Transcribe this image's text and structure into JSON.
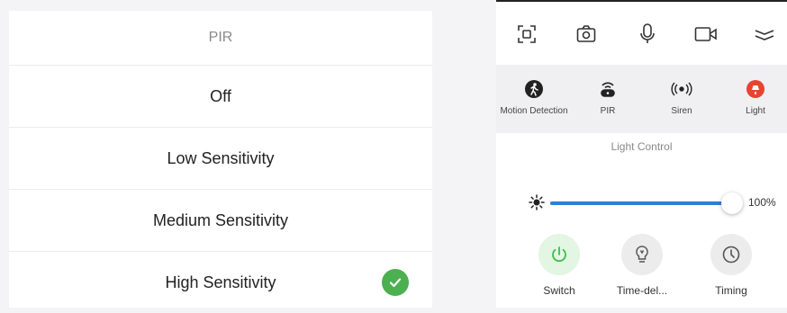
{
  "pir_menu": {
    "title": "PIR",
    "options": [
      "Off",
      "Low Sensitivity",
      "Medium Sensitivity",
      "High Sensitivity"
    ],
    "selected": "High Sensitivity"
  },
  "toolbar": {
    "icons": [
      "screen-capture-icon",
      "camera-icon",
      "microphone-icon",
      "video-icon",
      "collapse-icon"
    ]
  },
  "features": {
    "items": [
      {
        "label": "Motion Detection",
        "icon": "motion-detection-icon"
      },
      {
        "label": "PIR",
        "icon": "pir-icon"
      },
      {
        "label": "Siren",
        "icon": "siren-icon"
      },
      {
        "label": "Light",
        "icon": "light-icon",
        "color": "#e8442e"
      }
    ]
  },
  "light_control": {
    "title": "Light Control",
    "brightness": 100,
    "brightness_label": "100%",
    "controls": [
      {
        "label": "Switch",
        "icon": "power-icon",
        "bg": "#e3f5e3",
        "color": "#3cbf4a"
      },
      {
        "label": "Time-del...",
        "icon": "bulb-icon",
        "bg": "#ececec",
        "color": "#555555"
      },
      {
        "label": "Timing",
        "icon": "clock-icon",
        "bg": "#ececec",
        "color": "#555555"
      }
    ]
  },
  "colors": {
    "accent": "#2f7fd6",
    "check": "#4caf50"
  }
}
